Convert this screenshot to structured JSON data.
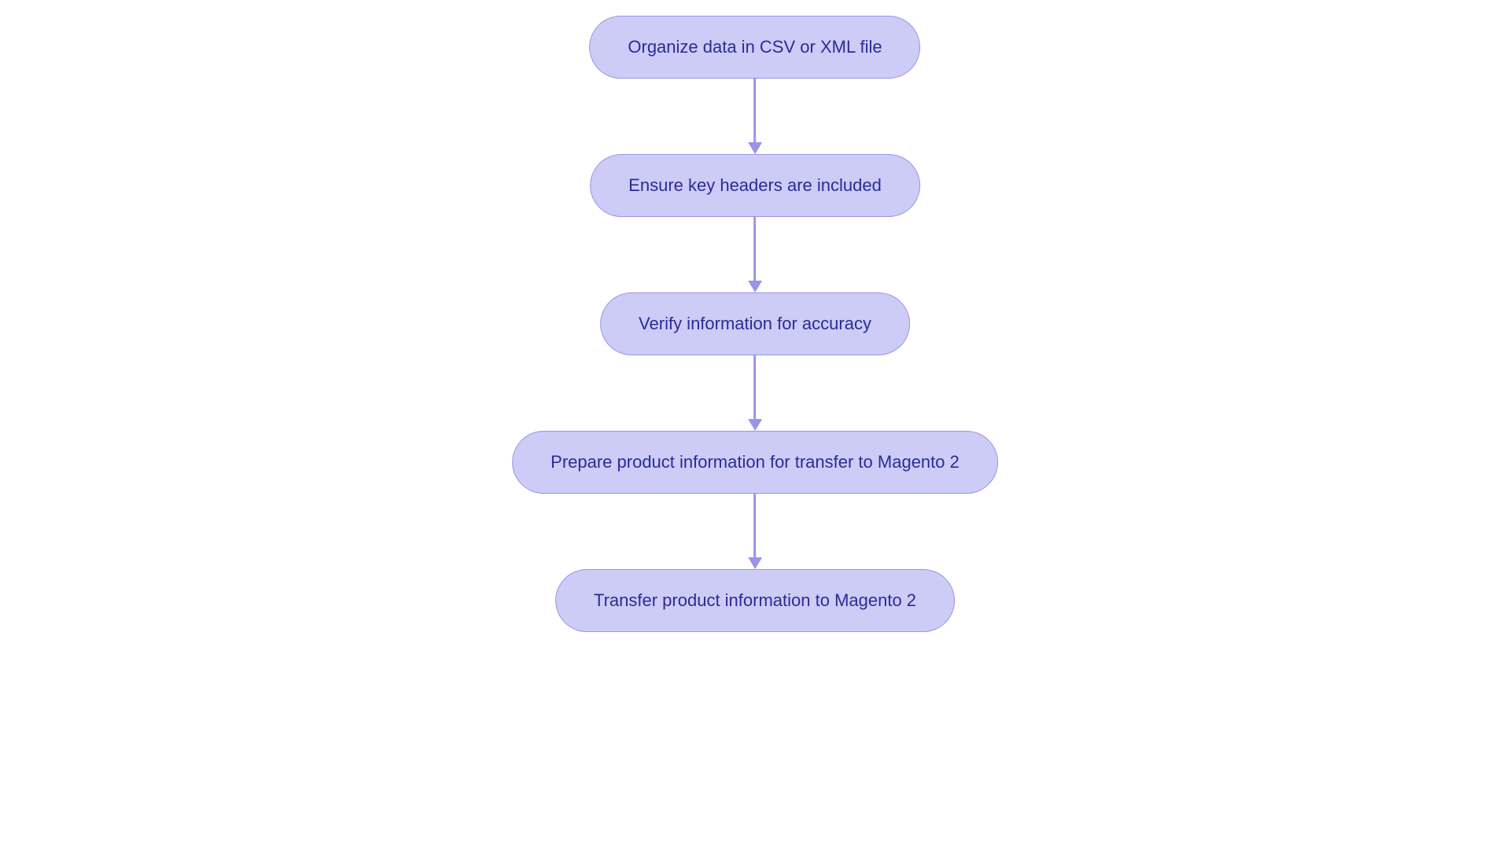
{
  "chart_data": {
    "type": "flowchart",
    "direction": "top-to-bottom",
    "nodes": [
      {
        "id": "n1",
        "label": "Organize data in CSV or XML file"
      },
      {
        "id": "n2",
        "label": "Ensure key headers are included"
      },
      {
        "id": "n3",
        "label": "Verify information for accuracy"
      },
      {
        "id": "n4",
        "label": "Prepare product information for transfer to Magento 2"
      },
      {
        "id": "n5",
        "label": "Transfer product information to Magento 2"
      }
    ],
    "edges": [
      {
        "from": "n1",
        "to": "n2"
      },
      {
        "from": "n2",
        "to": "n3"
      },
      {
        "from": "n3",
        "to": "n4"
      },
      {
        "from": "n4",
        "to": "n5"
      }
    ],
    "colors": {
      "node_fill": "#ccccf6",
      "node_border": "#9a94e8",
      "text": "#2b2b99",
      "arrow": "#9a94e8"
    }
  }
}
